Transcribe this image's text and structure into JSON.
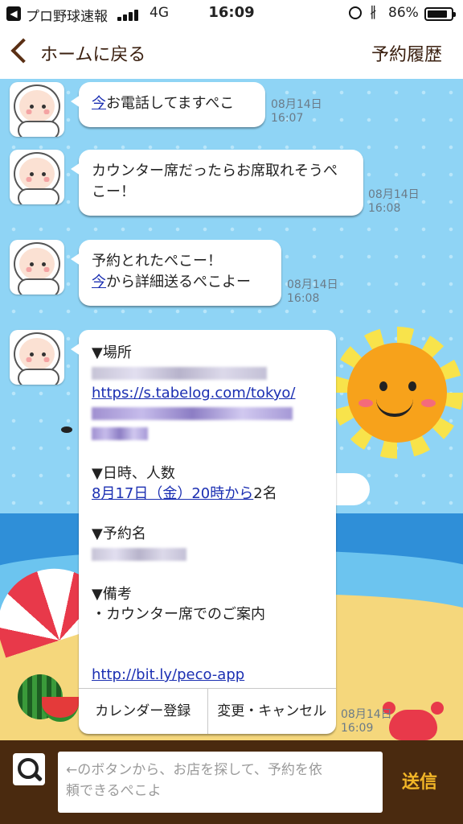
{
  "status_bar": {
    "app_back": "プロ野球速報",
    "network": "4G",
    "time": "16:09",
    "battery_percent": "86%",
    "battery_level": 0.86
  },
  "nav": {
    "back_label": "ホームに戻る",
    "history_label": "予約履歴"
  },
  "messages": [
    {
      "link": "今",
      "text": "お電話してますぺこ",
      "date": "08月14日",
      "time": "16:07"
    },
    {
      "line1": "カウンター席だったらお席取れそうぺ",
      "line2": "こー！",
      "date": "08月14日",
      "time": "16:08"
    },
    {
      "line1": "予約とれたぺこー！",
      "link": "今",
      "line2_rest": "から詳細送るぺこよー",
      "date": "08月14日",
      "time": "16:08"
    }
  ],
  "reservation": {
    "place_heading": "▼場所",
    "place_url": "https://s.tabelog.com/tokyo/",
    "datetime_heading": "▼日時、人数",
    "datetime_link": "8月17日（金）20時から",
    "party": "2名",
    "name_heading": "▼予約名",
    "notes_heading": "▼備考",
    "notes": "・カウンター席でのご案内",
    "app_url": "http://bit.ly/peco-app",
    "calendar_button": "カレンダー登録",
    "change_button": "変更・キャンセル",
    "date": "08月14日",
    "time": "16:09"
  },
  "input": {
    "placeholder_line1": "←のボタンから、お店を探して、予約を依",
    "placeholder_line2": "頼できるぺこよ",
    "send_label": "送信"
  },
  "colors": {
    "brand_brown": "#4a2a0f",
    "send_yellow": "#f2b627",
    "link_blue": "#1b2fb2",
    "sky": "#8fd4f5"
  }
}
